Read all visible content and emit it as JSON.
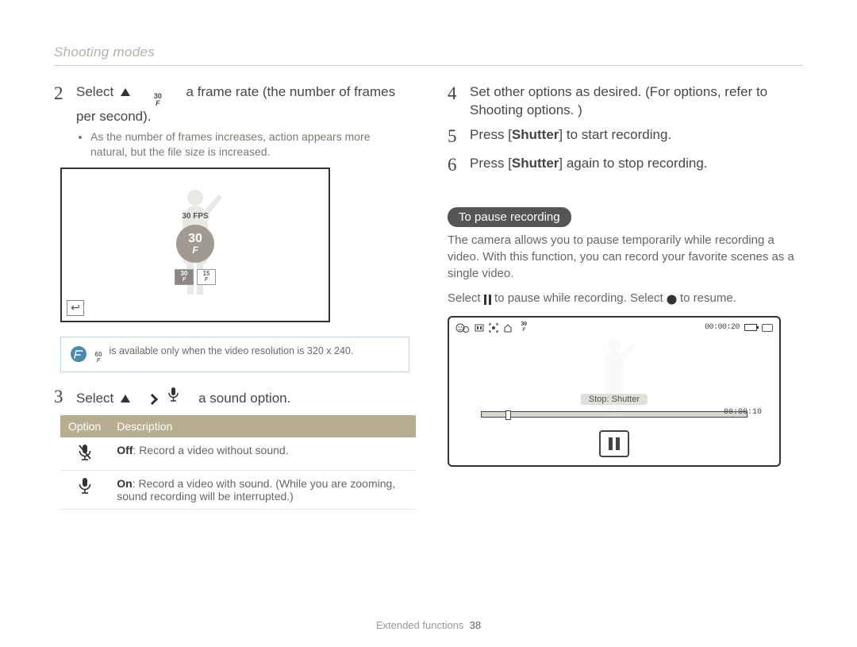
{
  "breadcrumb": "Shooting modes",
  "steps": {
    "s2": {
      "num": "2",
      "text_a": "Select",
      "text_b": "a frame rate (the number of frames per second).",
      "bullet": "As the number of frames increases, action appears more natural, but the file size is increased.",
      "fps_icon_value": "30"
    },
    "s3": {
      "num": "3",
      "text_a": "Select",
      "text_b": "a sound option."
    },
    "s4": {
      "num": "4",
      "text": "Set other options as desired. (For options, refer to Shooting options. )"
    },
    "s5": {
      "num": "5",
      "text_a": "Press [",
      "bold": "Shutter",
      "text_b": "] to start recording."
    },
    "s6": {
      "num": "6",
      "text_a": "Press [",
      "bold": "Shutter",
      "text_b": "] again to stop recording."
    }
  },
  "lcd1": {
    "fps_label": "30 FPS",
    "big": "30",
    "small1": "30",
    "small2": "15",
    "back_glyph": "↩"
  },
  "note": {
    "mini_fps": "60",
    "text": "is available only when the video resolution is 320 x 240."
  },
  "table": {
    "h1": "Option",
    "h2": "Description",
    "rows": [
      {
        "bold": "Off",
        "desc": ": Record a video without sound."
      },
      {
        "bold": "On",
        "desc": ": Record a video with sound. (While you are zooming, sound recording will be interrupted.)"
      }
    ]
  },
  "right": {
    "pill": "To pause recording",
    "para1": "The camera allows you to pause temporarily while recording a video. With this function, you can record your favorite scenes as a single video.",
    "para2_a": "Select ",
    "para2_b": " to pause while recording. Select ",
    "para2_c": " to resume."
  },
  "lcd2": {
    "time_top": "00:00:20",
    "stop_label": "Stop: Shutter",
    "time_prog": "00:00:10"
  },
  "footer": {
    "label": "Extended functions",
    "page": "38"
  }
}
